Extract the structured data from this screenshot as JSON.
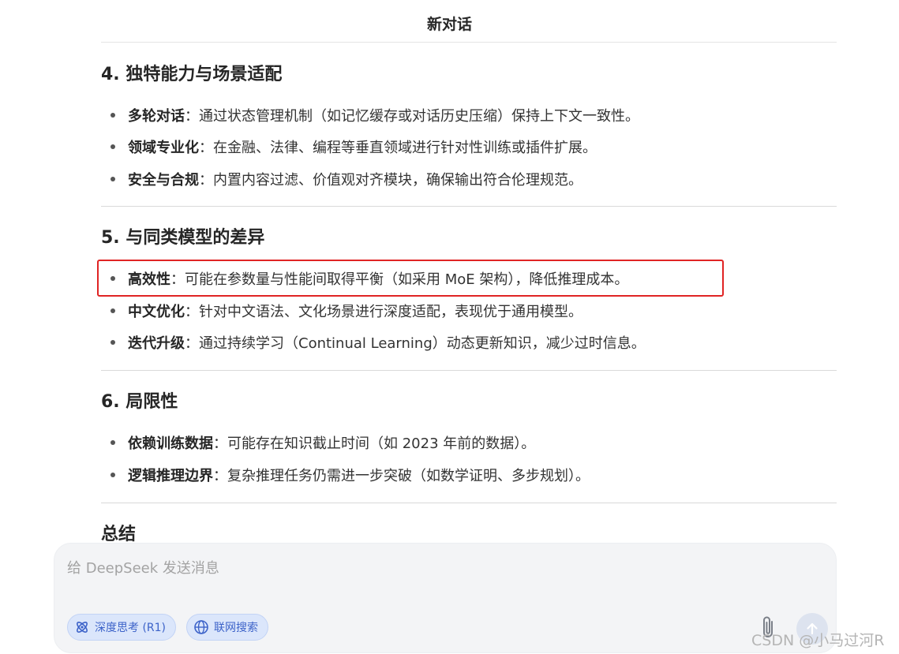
{
  "header": {
    "title": "新对话"
  },
  "sections": [
    {
      "title": "4. 独特能力与场景适配",
      "items": [
        {
          "term": "多轮对话",
          "text": "：通过状态管理机制（如记忆缓存或对话历史压缩）保持上下文一致性。"
        },
        {
          "term": "领域专业化",
          "text": "：在金融、法律、编程等垂直领域进行针对性训练或插件扩展。"
        },
        {
          "term": "安全与合规",
          "text": "：内置内容过滤、价值观对齐模块，确保输出符合伦理规范。"
        }
      ]
    },
    {
      "title": "5. 与同类模型的差异",
      "items": [
        {
          "term": "高效性",
          "text": "：可能在参数量与性能间取得平衡（如采用 MoE 架构），降低推理成本。"
        },
        {
          "term": "中文优化",
          "text": "：针对中文语法、文化场景进行深度适配，表现优于通用模型。"
        },
        {
          "term": "迭代升级",
          "text": "：通过持续学习（Continual Learning）动态更新知识，减少过时信息。"
        }
      ]
    },
    {
      "title": "6. 局限性",
      "items": [
        {
          "term": "依赖训练数据",
          "text": "：可能存在知识截止时间（如 2023 年前的数据）。"
        },
        {
          "term": "逻辑推理边界",
          "text": "：复杂推理任务仍需进一步突破（如数学证明、多步规划）。"
        }
      ]
    },
    {
      "title": "总结",
      "items": []
    }
  ],
  "composer": {
    "placeholder": "给 DeepSeek 发送消息",
    "deep_think_label": "深度思考 (R1)",
    "web_search_label": "联网搜索"
  },
  "watermark": "CSDN @小马过河R",
  "colors": {
    "highlight": "#e02424",
    "chip_text": "#3d63c9",
    "chip_bg": "#dbe6fb"
  }
}
